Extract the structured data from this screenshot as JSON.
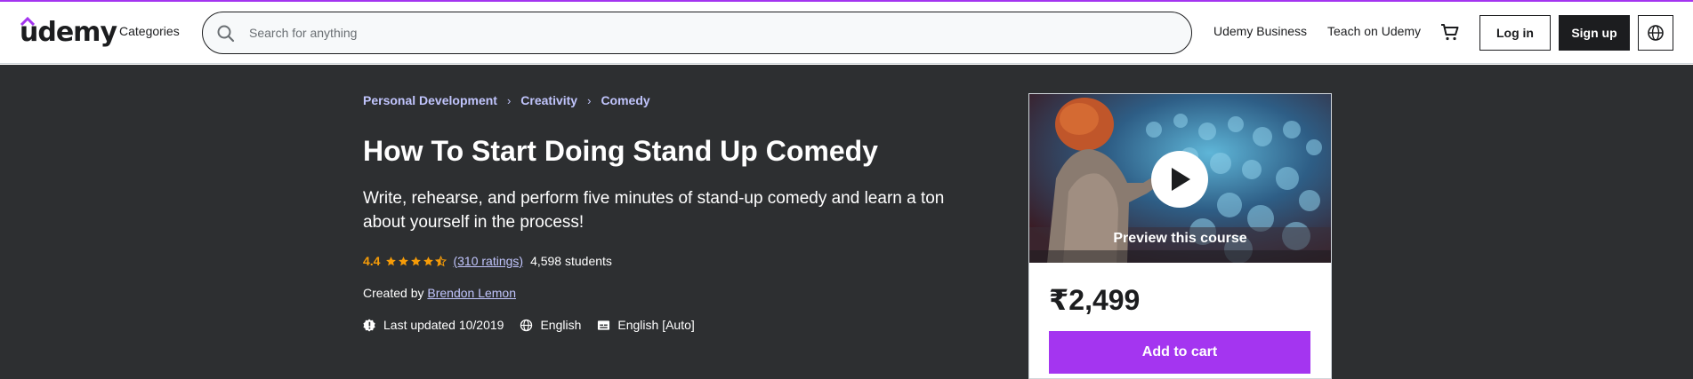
{
  "header": {
    "logo_text": "udemy",
    "categories_label": "Categories",
    "search_placeholder": "Search for anything",
    "udemy_business_label": "Udemy Business",
    "teach_label": "Teach on Udemy",
    "login_label": "Log in",
    "signup_label": "Sign up",
    "icons": [
      "search-icon",
      "cart-icon",
      "globe-icon"
    ]
  },
  "breadcrumb": {
    "items": [
      "Personal Development",
      "Creativity",
      "Comedy"
    ],
    "separator": "›"
  },
  "course": {
    "title": "How To Start Doing Stand Up Comedy",
    "subtitle": "Write, rehearse, and perform five minutes of stand-up comedy and learn a ton about yourself in the process!",
    "rating_value": "4.4",
    "rating_stars": 4.4,
    "ratings_count": "(310 ratings)",
    "students": "4,598 students",
    "created_by_label": "Created by",
    "instructor": "Brendon Lemon",
    "last_updated": "Last updated 10/2019",
    "language": "English",
    "captions": "English [Auto]"
  },
  "sidebar": {
    "preview_label": "Preview this course",
    "price": "₹2,499",
    "add_to_cart_label": "Add to cart"
  },
  "colors": {
    "brand_purple": "#a435f0",
    "hero_bg": "#2d2f31",
    "link_lavender": "#c0c4fc",
    "star_orange": "#f69c08"
  }
}
